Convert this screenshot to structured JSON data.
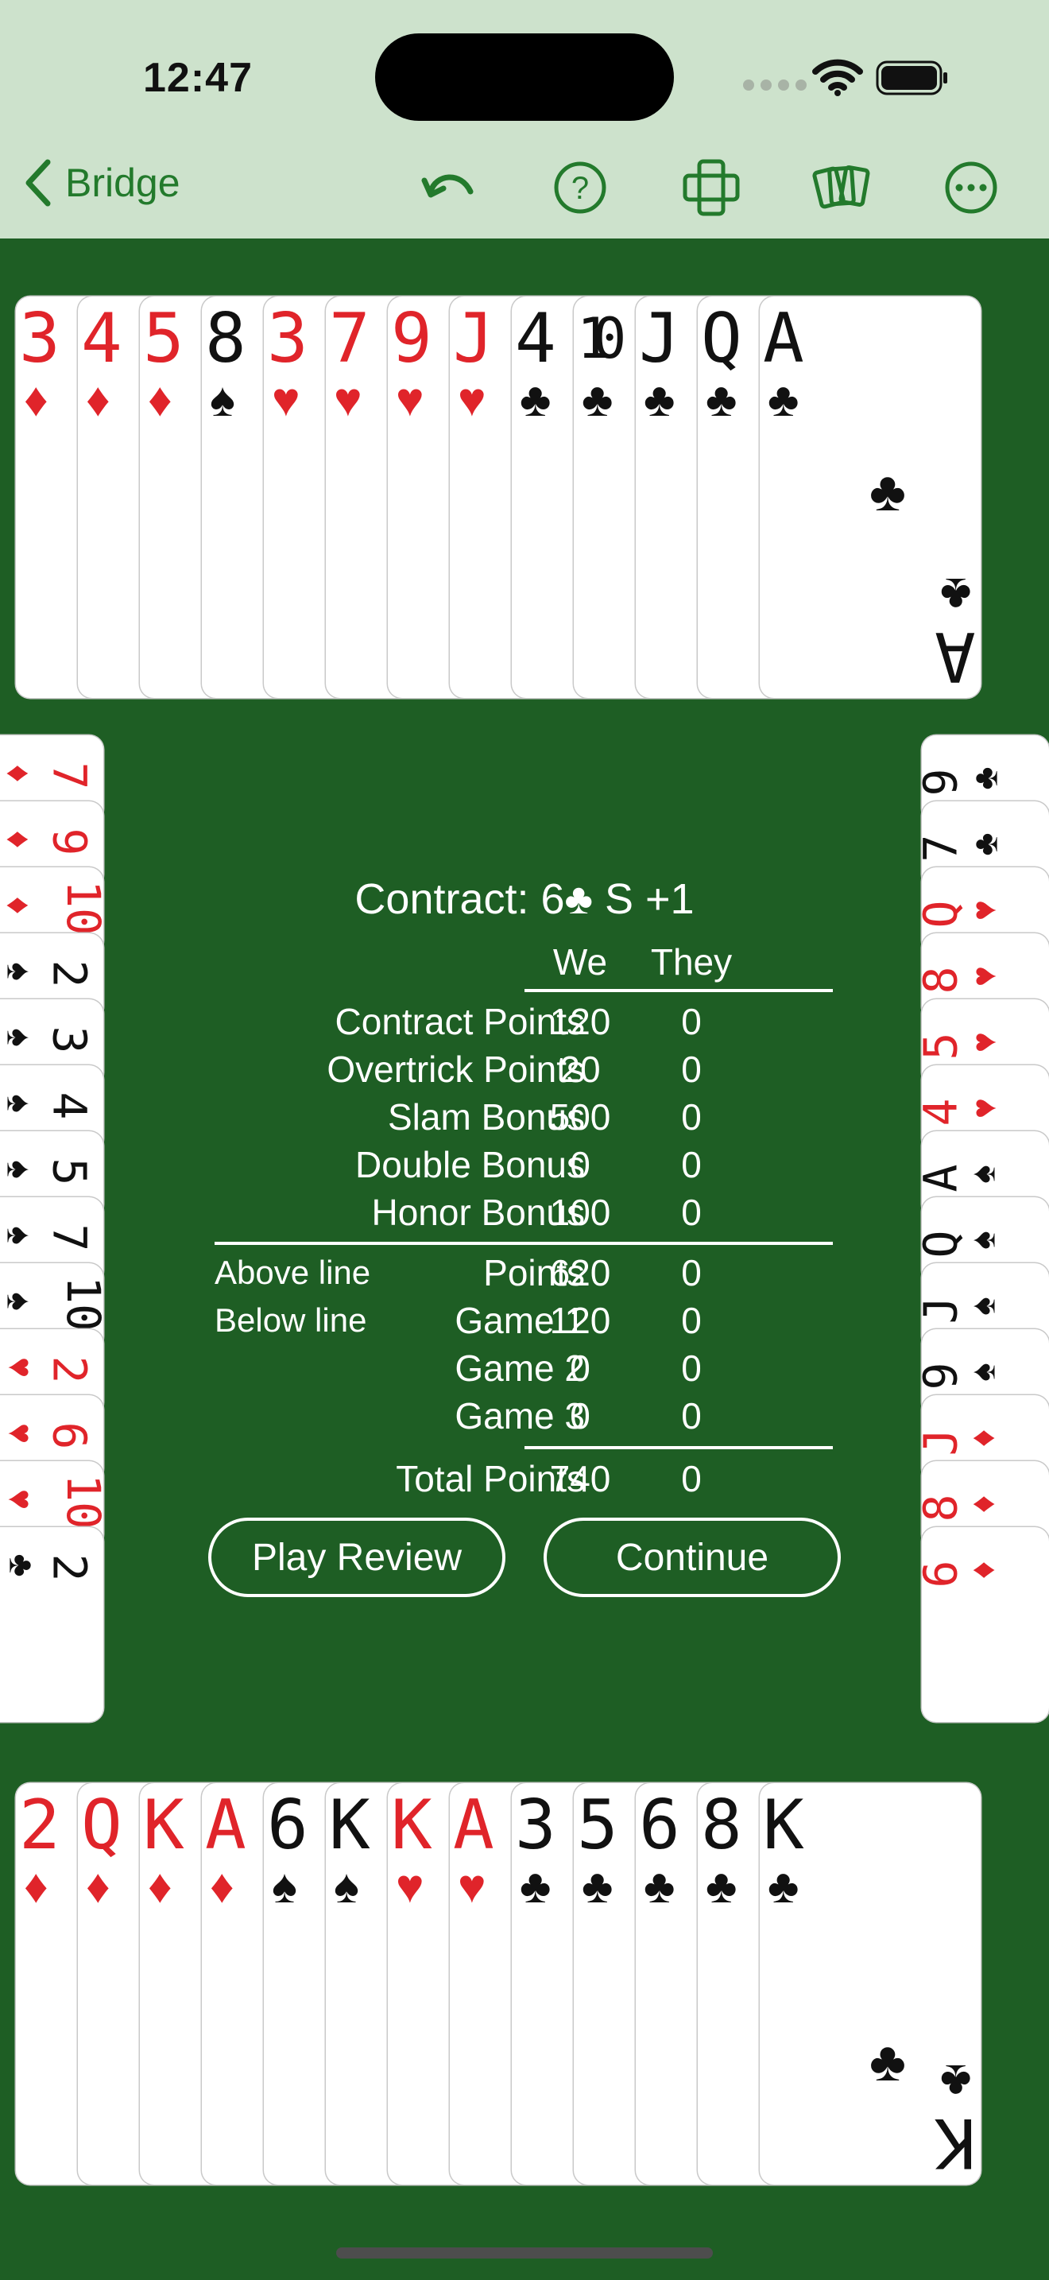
{
  "status": {
    "time": "12:47"
  },
  "nav": {
    "back_label": "Bridge"
  },
  "north": [
    {
      "r": "3",
      "s": "♦",
      "c": "red"
    },
    {
      "r": "4",
      "s": "♦",
      "c": "red"
    },
    {
      "r": "5",
      "s": "♦",
      "c": "red"
    },
    {
      "r": "8",
      "s": "♠",
      "c": "black"
    },
    {
      "r": "3",
      "s": "♥",
      "c": "red"
    },
    {
      "r": "7",
      "s": "♥",
      "c": "red"
    },
    {
      "r": "9",
      "s": "♥",
      "c": "red"
    },
    {
      "r": "J",
      "s": "♥",
      "c": "red"
    },
    {
      "r": "4",
      "s": "♣",
      "c": "black"
    },
    {
      "r": "10",
      "s": "♣",
      "c": "black"
    },
    {
      "r": "J",
      "s": "♣",
      "c": "black"
    },
    {
      "r": "Q",
      "s": "♣",
      "c": "black"
    },
    {
      "r": "A",
      "s": "♣",
      "c": "black"
    }
  ],
  "south": [
    {
      "r": "2",
      "s": "♦",
      "c": "red"
    },
    {
      "r": "Q",
      "s": "♦",
      "c": "red"
    },
    {
      "r": "K",
      "s": "♦",
      "c": "red"
    },
    {
      "r": "A",
      "s": "♦",
      "c": "red"
    },
    {
      "r": "6",
      "s": "♠",
      "c": "black"
    },
    {
      "r": "K",
      "s": "♠",
      "c": "black"
    },
    {
      "r": "K",
      "s": "♥",
      "c": "red"
    },
    {
      "r": "A",
      "s": "♥",
      "c": "red"
    },
    {
      "r": "3",
      "s": "♣",
      "c": "black"
    },
    {
      "r": "5",
      "s": "♣",
      "c": "black"
    },
    {
      "r": "6",
      "s": "♣",
      "c": "black"
    },
    {
      "r": "8",
      "s": "♣",
      "c": "black"
    },
    {
      "r": "K",
      "s": "♣",
      "c": "black"
    }
  ],
  "west": [
    {
      "r": "7",
      "s": "♦",
      "c": "red"
    },
    {
      "r": "9",
      "s": "♦",
      "c": "red"
    },
    {
      "r": "10",
      "s": "♦",
      "c": "red"
    },
    {
      "r": "2",
      "s": "♠",
      "c": "black"
    },
    {
      "r": "3",
      "s": "♠",
      "c": "black"
    },
    {
      "r": "4",
      "s": "♠",
      "c": "black"
    },
    {
      "r": "5",
      "s": "♠",
      "c": "black"
    },
    {
      "r": "7",
      "s": "♠",
      "c": "black"
    },
    {
      "r": "10",
      "s": "♠",
      "c": "black"
    },
    {
      "r": "2",
      "s": "♥",
      "c": "red"
    },
    {
      "r": "6",
      "s": "♥",
      "c": "red"
    },
    {
      "r": "10",
      "s": "♥",
      "c": "red"
    },
    {
      "r": "2",
      "s": "♣",
      "c": "black"
    }
  ],
  "east": [
    {
      "r": "9",
      "s": "♣",
      "c": "black"
    },
    {
      "r": "7",
      "s": "♣",
      "c": "black"
    },
    {
      "r": "Q",
      "s": "♥",
      "c": "red"
    },
    {
      "r": "8",
      "s": "♥",
      "c": "red"
    },
    {
      "r": "5",
      "s": "♥",
      "c": "red"
    },
    {
      "r": "4",
      "s": "♥",
      "c": "red"
    },
    {
      "r": "A",
      "s": "♠",
      "c": "black"
    },
    {
      "r": "Q",
      "s": "♠",
      "c": "black"
    },
    {
      "r": "J",
      "s": "♠",
      "c": "black"
    },
    {
      "r": "9",
      "s": "♠",
      "c": "black"
    },
    {
      "r": "J",
      "s": "♦",
      "c": "red"
    },
    {
      "r": "8",
      "s": "♦",
      "c": "red"
    },
    {
      "r": "6",
      "s": "♦",
      "c": "red"
    }
  ],
  "score": {
    "contract_prefix": "Contract: 6",
    "contract_suit": "♣",
    "contract_suffix": " S +1",
    "col_we": "We",
    "col_they": "They",
    "rows_top": [
      {
        "label": "Contract Points",
        "we": "120",
        "they": "0"
      },
      {
        "label": "Overtrick Points",
        "we": "20",
        "they": "0"
      },
      {
        "label": "Slam Bonus",
        "we": "500",
        "they": "0"
      },
      {
        "label": "Double Bonus",
        "we": "0",
        "they": "0"
      },
      {
        "label": "Honor Bonus",
        "we": "100",
        "they": "0"
      }
    ],
    "above_line": "Above line",
    "below_line": "Below line",
    "rows_mid": [
      {
        "label": "Points",
        "we": "620",
        "they": "0"
      },
      {
        "label": "Game 1",
        "we": "120",
        "they": "0"
      },
      {
        "label": "Game 2",
        "we": "0",
        "they": "0"
      },
      {
        "label": "Game 3",
        "we": "0",
        "they": "0"
      }
    ],
    "total": {
      "label": "Total Points",
      "we": "740",
      "they": "0"
    },
    "play_review": "Play Review",
    "continue": "Continue"
  }
}
